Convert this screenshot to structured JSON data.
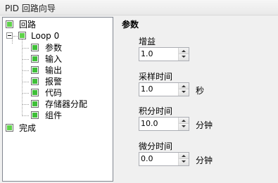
{
  "window": {
    "title": "PID 回路向导"
  },
  "tree": {
    "root": "回路",
    "loop": "Loop 0",
    "children": [
      "参数",
      "输入",
      "输出",
      "报警",
      "代码",
      "存储器分配",
      "组件"
    ],
    "finish": "完成"
  },
  "main": {
    "section_title": "参数",
    "fields": [
      {
        "label": "增益",
        "value": "1.0",
        "unit": ""
      },
      {
        "label": "采样时间",
        "value": "1.0",
        "unit": "秒"
      },
      {
        "label": "积分时间",
        "value": "10.0",
        "unit": "分钟"
      },
      {
        "label": "微分时间",
        "value": "0.0",
        "unit": "分钟"
      }
    ]
  }
}
